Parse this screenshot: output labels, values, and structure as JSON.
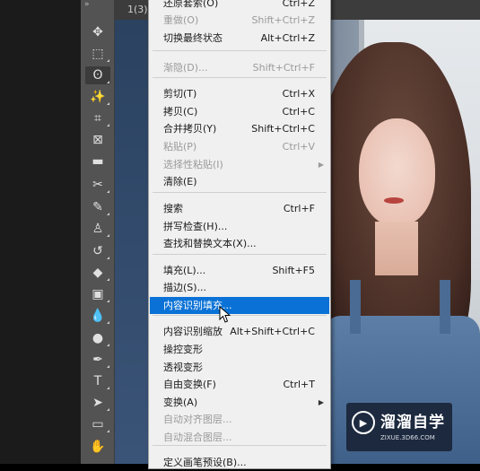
{
  "document": {
    "tab_label": "1(3).p"
  },
  "toolbar": {
    "tools": [
      {
        "icon": "move-icon",
        "glyph": "✥"
      },
      {
        "icon": "marquee-icon",
        "glyph": "⬚"
      },
      {
        "icon": "lasso-icon",
        "glyph": "ʘ"
      },
      {
        "icon": "magic-wand-icon",
        "glyph": "✨"
      },
      {
        "icon": "crop-icon",
        "glyph": "⌗"
      },
      {
        "icon": "frame-icon",
        "glyph": "⊠"
      },
      {
        "icon": "ruler-icon",
        "glyph": "▬"
      },
      {
        "icon": "healing-brush-icon",
        "glyph": "✂"
      },
      {
        "icon": "brush-icon",
        "glyph": "✎"
      },
      {
        "icon": "clone-stamp-icon",
        "glyph": "♙"
      },
      {
        "icon": "history-brush-icon",
        "glyph": "↺"
      },
      {
        "icon": "eraser-icon",
        "glyph": "◆"
      },
      {
        "icon": "gradient-icon",
        "glyph": "▣"
      },
      {
        "icon": "blur-icon",
        "glyph": "💧"
      },
      {
        "icon": "dodge-icon",
        "glyph": "●"
      },
      {
        "icon": "pen-icon",
        "glyph": "✒"
      },
      {
        "icon": "type-icon",
        "glyph": "T"
      },
      {
        "icon": "path-selection-icon",
        "glyph": "➤"
      },
      {
        "icon": "rectangle-shape-icon",
        "glyph": "▭"
      },
      {
        "icon": "hand-icon",
        "glyph": "✋"
      }
    ]
  },
  "menu": {
    "items": [
      {
        "label": "还原套索(O)",
        "shortcut": "Ctrl+Z",
        "disabled": false
      },
      {
        "label": "重做(O)",
        "shortcut": "Shift+Ctrl+Z",
        "disabled": true
      },
      {
        "label": "切换最终状态",
        "shortcut": "Alt+Ctrl+Z",
        "disabled": false
      },
      {
        "label": "渐隐(D)...",
        "shortcut": "Shift+Ctrl+F",
        "disabled": true
      },
      {
        "label": "剪切(T)",
        "shortcut": "Ctrl+X",
        "disabled": false
      },
      {
        "label": "拷贝(C)",
        "shortcut": "Ctrl+C",
        "disabled": false
      },
      {
        "label": "合并拷贝(Y)",
        "shortcut": "Shift+Ctrl+C",
        "disabled": false
      },
      {
        "label": "粘贴(P)",
        "shortcut": "Ctrl+V",
        "disabled": true
      },
      {
        "label": "选择性粘贴(I)",
        "shortcut": "",
        "disabled": true,
        "submenu": true
      },
      {
        "label": "清除(E)",
        "shortcut": "",
        "disabled": false
      },
      {
        "label": "搜索",
        "shortcut": "Ctrl+F",
        "disabled": false
      },
      {
        "label": "拼写检查(H)...",
        "shortcut": "",
        "disabled": false
      },
      {
        "label": "查找和替换文本(X)...",
        "shortcut": "",
        "disabled": false
      },
      {
        "label": "填充(L)...",
        "shortcut": "Shift+F5",
        "disabled": false
      },
      {
        "label": "描边(S)...",
        "shortcut": "",
        "disabled": false
      },
      {
        "label": "内容识别填充...",
        "shortcut": "",
        "disabled": false,
        "highlighted": true
      },
      {
        "label": "内容识别缩放",
        "shortcut": "Alt+Shift+Ctrl+C",
        "disabled": false
      },
      {
        "label": "操控变形",
        "shortcut": "",
        "disabled": false
      },
      {
        "label": "透视变形",
        "shortcut": "",
        "disabled": false
      },
      {
        "label": "自由变换(F)",
        "shortcut": "Ctrl+T",
        "disabled": false
      },
      {
        "label": "变换(A)",
        "shortcut": "",
        "disabled": false,
        "submenu": true
      },
      {
        "label": "自动对齐图层...",
        "shortcut": "",
        "disabled": true
      },
      {
        "label": "自动混合图层...",
        "shortcut": "",
        "disabled": true
      },
      {
        "label": "定义画笔预设(B)...",
        "shortcut": "",
        "disabled": false
      }
    ]
  },
  "watermark": {
    "brand": "溜溜自学",
    "url": "ZIXUE.3D66.COM",
    "logo_icon": "play-icon"
  },
  "colors": {
    "menu_highlight": "#0a72d6",
    "menu_background": "#f0f0f0",
    "toolbar_background": "#535353"
  }
}
